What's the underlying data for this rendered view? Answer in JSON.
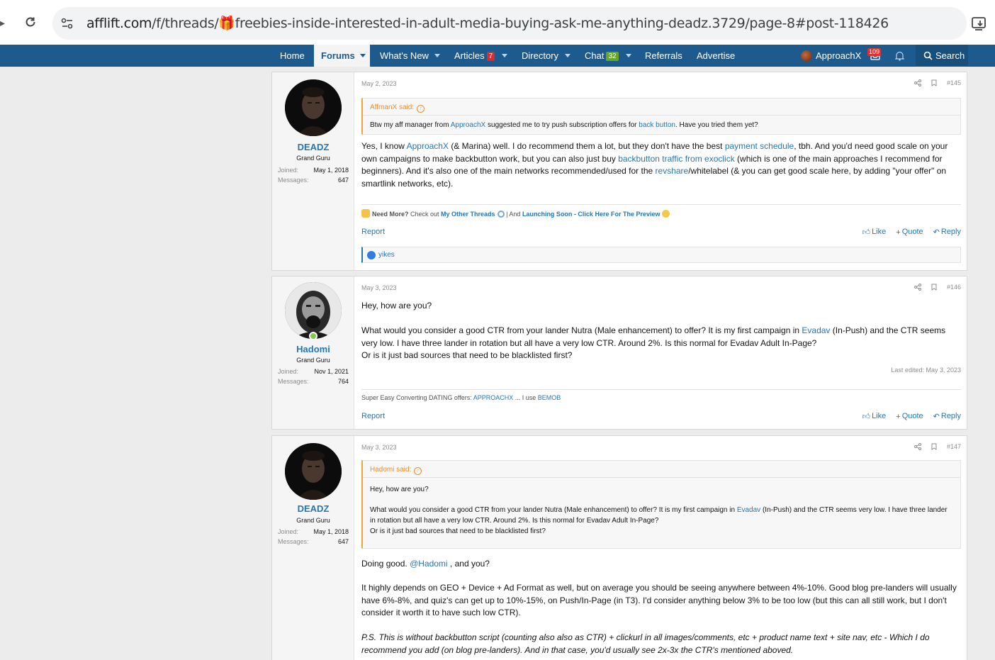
{
  "browser": {
    "url_host": "afflift.com",
    "url_path": "/f/threads/🎁freebies-inside-interested-in-adult-media-buying-ask-me-anything-deadz.3729/page-8#post-118426"
  },
  "nav": {
    "home": "Home",
    "forums": "Forums",
    "whats_new": "What's New",
    "articles": "Articles",
    "articles_badge": "7",
    "directory": "Directory",
    "chat": "Chat",
    "chat_badge": "32",
    "referrals": "Referrals",
    "advertise": "Advertise",
    "username": "ApproachX",
    "alerts_badge": "109",
    "search": "Search"
  },
  "colors": {
    "nav_bg": "#1d5a8d",
    "link": "#2577b1",
    "quote_accent": "#f08c2c"
  },
  "posts": [
    {
      "date": "May 2, 2023",
      "number": "#145",
      "user": {
        "name": "DEADZ",
        "title": "Grand Guru",
        "joined_label": "Joined:",
        "joined": "May 1, 2018",
        "messages_label": "Messages:",
        "messages": "647"
      },
      "quote": {
        "author": "AffmanX said:",
        "text_a": "Btw my aff manager from ",
        "link_a": "ApproachX",
        "text_b": " suggested me to try push subscription offers for ",
        "link_b": "back button",
        "text_c": ". Have you tried them yet?"
      },
      "body": {
        "t1": "Yes, I know ",
        "l1": "ApproachX",
        "t2": " (& Marina) well. I do recommend them a lot, but they don't have the best ",
        "l2": "payment schedule",
        "t3": ", tbh. And you'd need good scale on your own campaigns to make backbutton work, but you can also just buy ",
        "l3": "backbutton traffic from exoclick",
        "t4": " (which is one of the main approaches I recommend for beginners). And it's also one of the main networks recommended/used for the ",
        "l4": "revshare",
        "t5": "/whitelabel (& you can get good scale here, by adding \"your offer\" on smartlink networks, etc)."
      },
      "signature": {
        "need_more": "Need More?",
        "check_out": " Check out ",
        "threads": "My Other Threads",
        "and": " | And ",
        "launching": "Launching Soon - Click Here For The Preview"
      },
      "report": "Report",
      "like": "Like",
      "quote_action": "Quote",
      "reply": "Reply",
      "reaction_user": "yikes"
    },
    {
      "date": "May 3, 2023",
      "number": "#146",
      "user": {
        "name": "Hadomi",
        "title": "Grand Guru",
        "joined_label": "Joined:",
        "joined": "Nov 1, 2021",
        "messages_label": "Messages:",
        "messages": "764"
      },
      "body": {
        "p1": "Hey, how are you?",
        "p2a": "What would you consider a good CTR from your lander Nutra (Male enhancement) to offer? It is my first campaign in ",
        "p2link": "Evadav",
        "p2b": " (In-Push) and the CTR seems very low. I have three lander in rotation but all have a very low CTR. Around 2%. Is this normal for Evadav Adult In-Page?",
        "p3": "Or is it just bad sources that need to be blacklisted first?"
      },
      "last_edited": "Last edited: May 3, 2023",
      "signature": {
        "text_a": "Super Easy Converting DATING offers: ",
        "link_a": "APPROACHX",
        "text_b": " ... I use ",
        "link_b": "BEMOB"
      },
      "report": "Report",
      "like": "Like",
      "quote_action": "Quote",
      "reply": "Reply"
    },
    {
      "date": "May 3, 2023",
      "number": "#147",
      "user": {
        "name": "DEADZ",
        "title": "Grand Guru",
        "joined_label": "Joined:",
        "joined": "May 1, 2018",
        "messages_label": "Messages:",
        "messages": "647"
      },
      "quote": {
        "author": "Hadomi said:",
        "p1": "Hey, how are you?",
        "p2a": "What would you consider a good CTR from your lander Nutra (Male enhancement) to offer? It is my first campaign in ",
        "p2link": "Evadav",
        "p2b": " (In-Push) and the CTR seems very low. I have three lander in rotation but all have a very low CTR. Around 2%. Is this normal for Evadav Adult In-Page?",
        "p3": "Or is it just bad sources that need to be blacklisted first?"
      },
      "body": {
        "p1a": "Doing good. ",
        "p1mention": "@Hadomi",
        "p1b": " , and you?",
        "p2": "It highly depends on GEO + Device + Ad Format as well, but on average you should be seeing anywhere between 4%-10%. Good blog pre-landers will usually have 6%-8%, and quiz's can get up to 10%-15%, on Push/In-Page (in T3). I'd consider anything below 3% to be too low (but this can all still work, but I don't consider it worth it to have such low CTR).",
        "p3": "P.S. This is without backbutton script (counting also also as CTR) + clickurl in all images/comments, etc + product name text + site nav, etc - Which I do recommend you add (on blog pre-landers). And in that case, you'd usually see 2x-3x the CTR's mentioned aboved."
      }
    }
  ]
}
